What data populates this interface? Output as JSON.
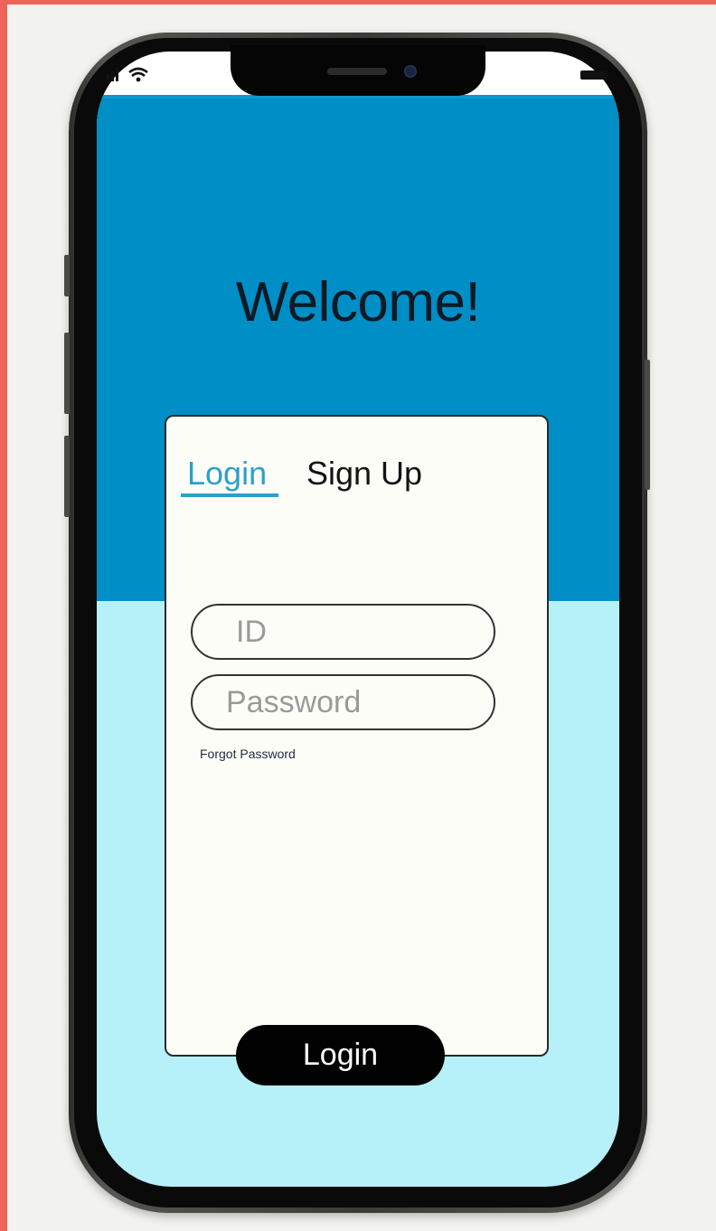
{
  "screen": {
    "welcome_text": "Welcome!"
  },
  "auth_card": {
    "tabs": [
      {
        "label": "Login",
        "active": true
      },
      {
        "label": "Sign Up",
        "active": false
      }
    ],
    "id_field": {
      "placeholder": "ID",
      "value": ""
    },
    "password_field": {
      "placeholder": "Password",
      "value": ""
    },
    "forgot_password_label": "Forgot Password",
    "submit_label": "Login"
  },
  "theme": {
    "hero_color": "#008ec6",
    "lower_background": "#b6f0f9",
    "active_tab_color": "#2d9fca",
    "button_color": "#020202",
    "page_border_accent": "#ef6457"
  },
  "icons": {
    "status_left": [
      "signal-icon",
      "wifi-icon"
    ],
    "status_right": [
      "battery-icon"
    ]
  }
}
